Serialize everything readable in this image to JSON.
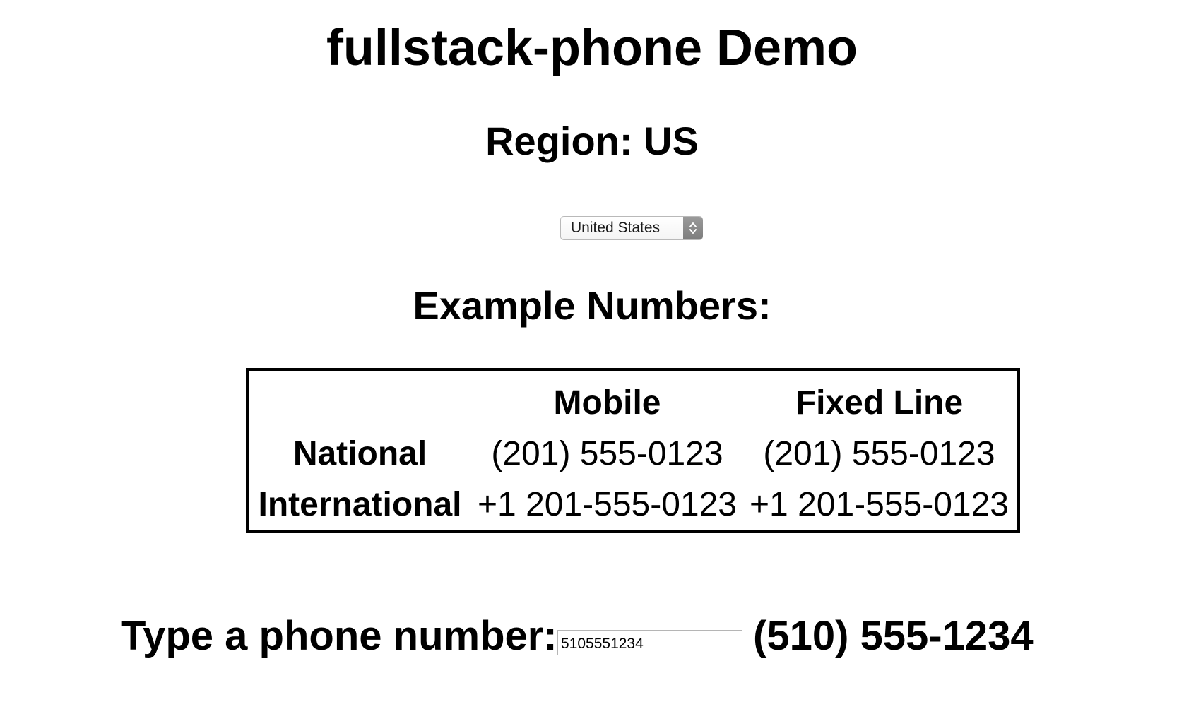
{
  "page": {
    "title": "fullstack-phone Demo",
    "region_heading": "Region: US"
  },
  "region_select": {
    "selected": "United States",
    "stepper_icon": "updown-chevron-icon"
  },
  "examples": {
    "heading": "Example Numbers:",
    "columns": [
      "",
      "Mobile",
      "Fixed Line"
    ],
    "rows": [
      {
        "label": "National",
        "mobile": "(201) 555-0123",
        "fixed_line": "(201) 555-0123"
      },
      {
        "label": "International",
        "mobile": "+1 201-555-0123",
        "fixed_line": "+1 201-555-0123"
      }
    ]
  },
  "phone_entry": {
    "label": "Type a phone number:",
    "value": "5105551234",
    "formatted": "(510) 555-1234"
  }
}
